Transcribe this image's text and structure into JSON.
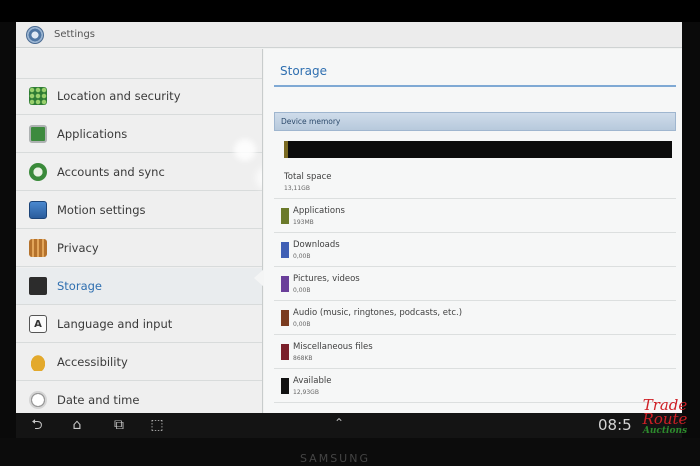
{
  "titlebar": {
    "title": "Settings",
    "icon": "settings-gear-icon"
  },
  "menu": {
    "items": [
      {
        "label": "Location and security",
        "icon": "location-grid-icon"
      },
      {
        "label": "Applications",
        "icon": "applications-icon"
      },
      {
        "label": "Accounts and sync",
        "icon": "sync-icon"
      },
      {
        "label": "Motion settings",
        "icon": "motion-icon"
      },
      {
        "label": "Privacy",
        "icon": "privacy-fence-icon"
      },
      {
        "label": "Storage",
        "icon": "sd-card-icon",
        "selected": true
      },
      {
        "label": "Language and input",
        "icon": "keyboard-a-icon",
        "glyph": "A"
      },
      {
        "label": "Accessibility",
        "icon": "hand-icon"
      },
      {
        "label": "Date and time",
        "icon": "clock-icon"
      }
    ]
  },
  "pane": {
    "title": "Storage",
    "section": "Device memory",
    "total": {
      "name": "Total space",
      "value": "13,11GB"
    },
    "rows": [
      {
        "name": "Applications",
        "value": "193MB",
        "color": "#6b7a2a"
      },
      {
        "name": "Downloads",
        "value": "0,00B",
        "color": "#3f5fb5"
      },
      {
        "name": "Pictures, videos",
        "value": "0,00B",
        "color": "#6a3f9a"
      },
      {
        "name": "Audio (music, ringtones, podcasts, etc.)",
        "value": "0,00B",
        "color": "#7a3b1f"
      },
      {
        "name": "Miscellaneous files",
        "value": "868KB",
        "color": "#7a1f2a"
      },
      {
        "name": "Available",
        "value": "12,93GB",
        "color": "#111111"
      }
    ]
  },
  "navbar": {
    "clock": "08:5",
    "icons": [
      "back-icon",
      "home-icon",
      "recent-apps-icon",
      "screenshot-icon",
      "chevron-up-icon"
    ]
  },
  "watermark": {
    "line1": "Trade",
    "line2": "Route",
    "line3": "Auctions"
  },
  "device": {
    "brand": "SAMSUNG"
  }
}
